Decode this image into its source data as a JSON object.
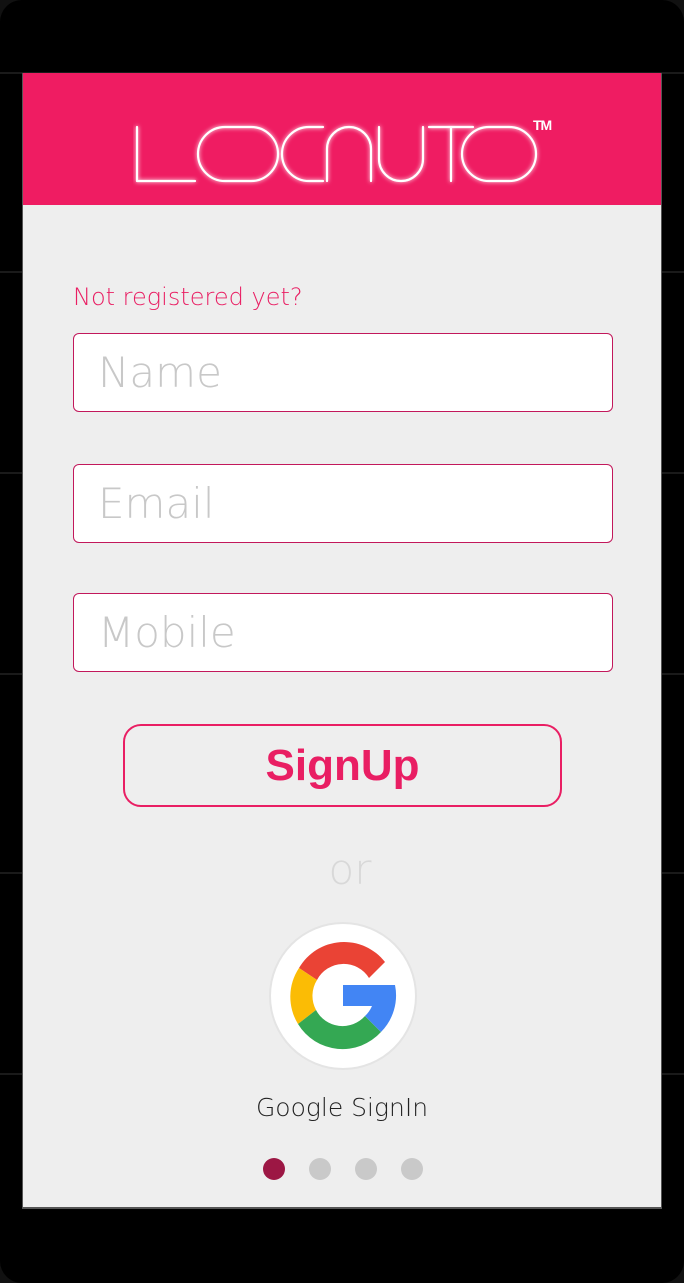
{
  "app": {
    "logo_text": "LOCNUTO",
    "trademark": "TM"
  },
  "form": {
    "prompt": "Not registered yet?",
    "name": {
      "placeholder": "Name",
      "value": ""
    },
    "email": {
      "placeholder": "Email",
      "value": ""
    },
    "mobile": {
      "placeholder": "Mobile",
      "value": ""
    },
    "signup_label": "SignUp"
  },
  "alt": {
    "or_label": "or",
    "google_label": "Google SignIn",
    "google_icon": "google-g-icon"
  },
  "pager": {
    "count": 4,
    "active_index": 0
  },
  "colors": {
    "brand": "#ef1c62",
    "accent_text": "#e91e63",
    "field_border": "#c2185b",
    "screen_bg": "#eeeeee",
    "dot_active": "#9c1744",
    "dot_inactive": "#c9c9c9"
  }
}
